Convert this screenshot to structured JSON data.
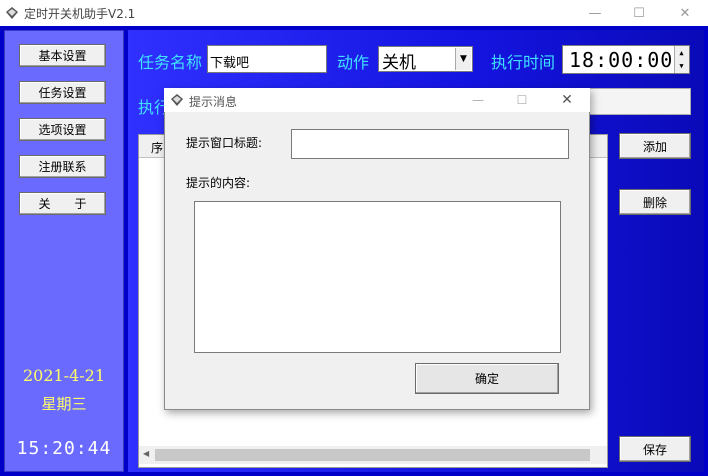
{
  "window": {
    "title": "定时开关机助手V2.1",
    "minimize": "—",
    "maximize": "☐",
    "close": "✕"
  },
  "sidebar": {
    "items": [
      {
        "label": "基本设置"
      },
      {
        "label": "任务设置"
      },
      {
        "label": "选项设置"
      },
      {
        "label": "注册联系"
      },
      {
        "label": "关　　于"
      }
    ],
    "date": "2021-4-21",
    "weekday": "星期三",
    "clock": "15:20:44"
  },
  "main": {
    "task_name_label": "任务名称",
    "task_name_value": "下载吧",
    "action_label": "动作",
    "action_value": "关机",
    "exec_time_label": "执行时间",
    "exec_time_value": "18:00:00",
    "exec_label_partial": "执行",
    "table_col_seq": "序",
    "add_button": "添加",
    "delete_button": "删除",
    "save_button": "保存"
  },
  "dialog": {
    "title": "提示消息",
    "window_title_label": "提示窗口标题:",
    "window_title_value": "",
    "content_label": "提示的内容:",
    "content_value": "",
    "ok_button": "确定"
  },
  "colors": {
    "sidebar_bg": "#6a6aff",
    "main_bg": "#1414e0",
    "label_cyan": "#40e0ff",
    "date_yellow": "#ffff66"
  }
}
